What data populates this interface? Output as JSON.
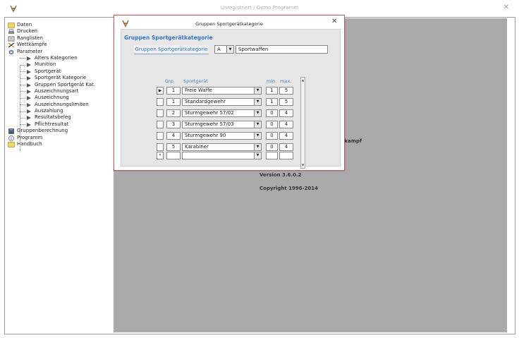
{
  "window": {
    "title": "Unregistriert  /  Demo Programm",
    "close": "✕"
  },
  "tree": {
    "items": [
      {
        "label": "Daten",
        "icon": "folder-icon"
      },
      {
        "label": "Drucken",
        "icon": "printer-icon"
      },
      {
        "label": "Ranglisten",
        "icon": "ranking-icon"
      },
      {
        "label": "Wettkämpfe",
        "icon": "crossed-swords-icon"
      },
      {
        "label": "Parameter",
        "icon": "settings-icon"
      }
    ],
    "subitems": [
      "Alters Kategorien",
      "Munition",
      "Sportgerät",
      "Sportgerät Kategorie",
      "Gruppen Sportgerät Kat.",
      "Auszeichnungsart",
      "Auszeichnung",
      "Auszeichnungslimiten",
      "Auszahlung",
      "Resultatsbeleg",
      "Pflichtresultat"
    ],
    "bottom_items": [
      {
        "label": "Gruppenberechnung",
        "icon": "book-icon"
      },
      {
        "label": "Programm",
        "icon": "info-icon"
      },
      {
        "label": "Handbuch",
        "icon": "folder-icon"
      }
    ]
  },
  "background": {
    "fragment": "tkampf",
    "version": "Version 3.6.0.2",
    "copyright": "Copyright  1996-2014"
  },
  "dialog": {
    "title": "Gruppen Sportgerätkategorie",
    "close": "✕",
    "section_title": "Gruppen Sportgerätkategorie",
    "field_label": "Gruppen Sportgerätkategorie",
    "code_value": "A",
    "name_value": "Sportwaffen",
    "columns": {
      "grp": "Grp.",
      "sportgeraet": "Sportgerät",
      "min": "min.",
      "max": "max."
    },
    "rows": [
      {
        "grp": "1",
        "sportgeraet": "Freie Waffe",
        "min": "1",
        "max": "5",
        "current": true
      },
      {
        "grp": "1",
        "sportgeraet": "Standardgewehr",
        "min": "1",
        "max": "5"
      },
      {
        "grp": "2",
        "sportgeraet": "Sturmgewehr 57/02",
        "min": "0",
        "max": "4"
      },
      {
        "grp": "3",
        "sportgeraet": "Sturmgewehr 57/03",
        "min": "0",
        "max": "4"
      },
      {
        "grp": "4",
        "sportgeraet": "Sturmgewehr 90",
        "min": "0",
        "max": "4"
      },
      {
        "grp": "5",
        "sportgeraet": "Karabiner",
        "min": "0",
        "max": "4"
      }
    ],
    "current_row_marker": "▶",
    "new_row_marker": "*",
    "dropdown_glyph": "▼"
  }
}
